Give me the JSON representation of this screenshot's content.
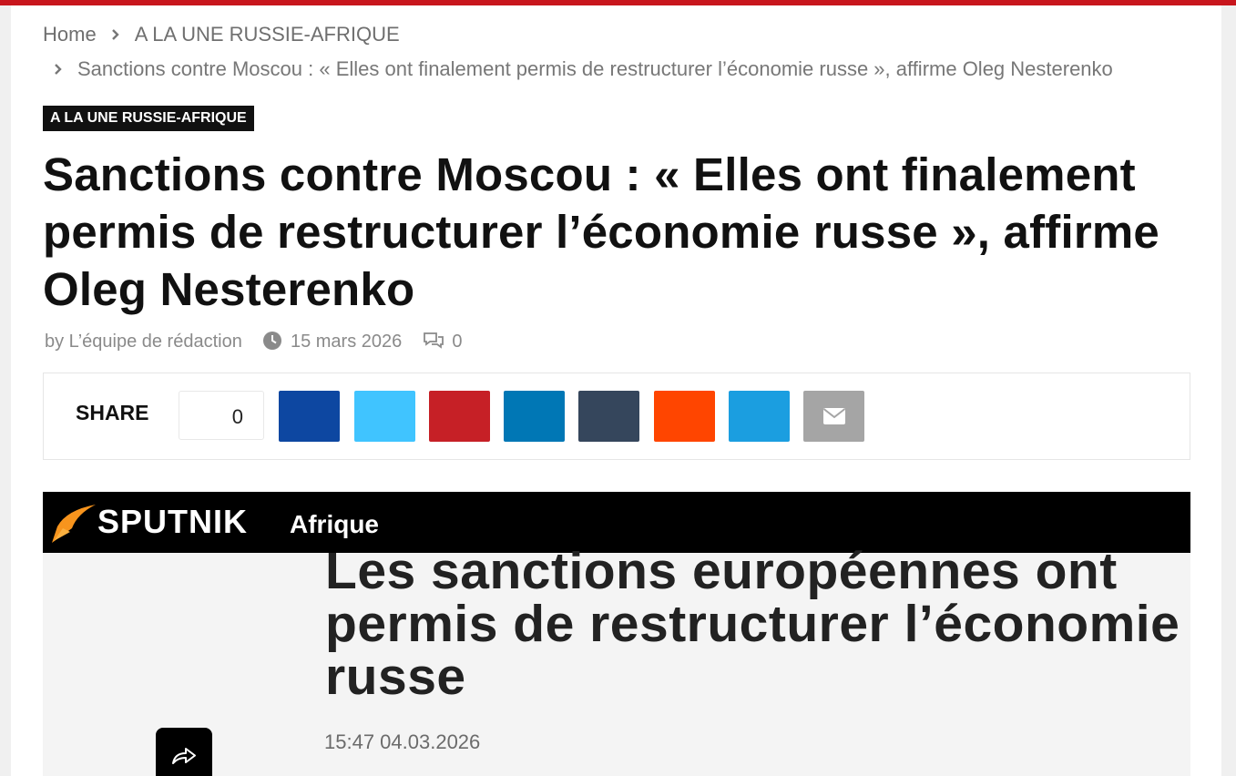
{
  "colors": {
    "accent": "#c8161d",
    "facebook": "#0d47a1",
    "twitter": "#40c4ff",
    "pinterest": "#c62026",
    "linkedin": "#0077b5",
    "tumblr": "#35465c",
    "reddit": "#ff4500",
    "telegram": "#1b9ee0",
    "email": "#a5a5a5"
  },
  "breadcrumb": {
    "home": "Home",
    "category": "A LA UNE RUSSIE-AFRIQUE",
    "current": "Sanctions contre Moscou : « Elles ont finalement permis de restructurer l’économie russe », affirme Oleg Nesterenko"
  },
  "article": {
    "category_badge": "A LA UNE RUSSIE-AFRIQUE",
    "title": "Sanctions contre Moscou : « Elles ont finalement permis de restructurer l’économie russe », affirme Oleg Nesterenko",
    "author": "by L’équipe de rédaction",
    "date": "15 mars 2026",
    "comments_count": "0"
  },
  "share": {
    "label": "SHARE",
    "count": "0",
    "buttons": [
      {
        "network": "facebook",
        "icon": "facebook-icon"
      },
      {
        "network": "twitter",
        "icon": "twitter-icon"
      },
      {
        "network": "pinterest",
        "icon": "pinterest-icon"
      },
      {
        "network": "linkedin",
        "icon": "linkedin-icon"
      },
      {
        "network": "tumblr",
        "icon": "tumblr-icon"
      },
      {
        "network": "reddit",
        "icon": "reddit-icon"
      },
      {
        "network": "telegram",
        "icon": "telegram-icon"
      },
      {
        "network": "email",
        "icon": "envelope-icon"
      }
    ]
  },
  "figure": {
    "brand": "SPUTNIK",
    "region": "Afrique",
    "title": "Les sanctions européennes ont permis de restructurer l’économie russe",
    "timestamp": "15:47 04.03.2026"
  }
}
